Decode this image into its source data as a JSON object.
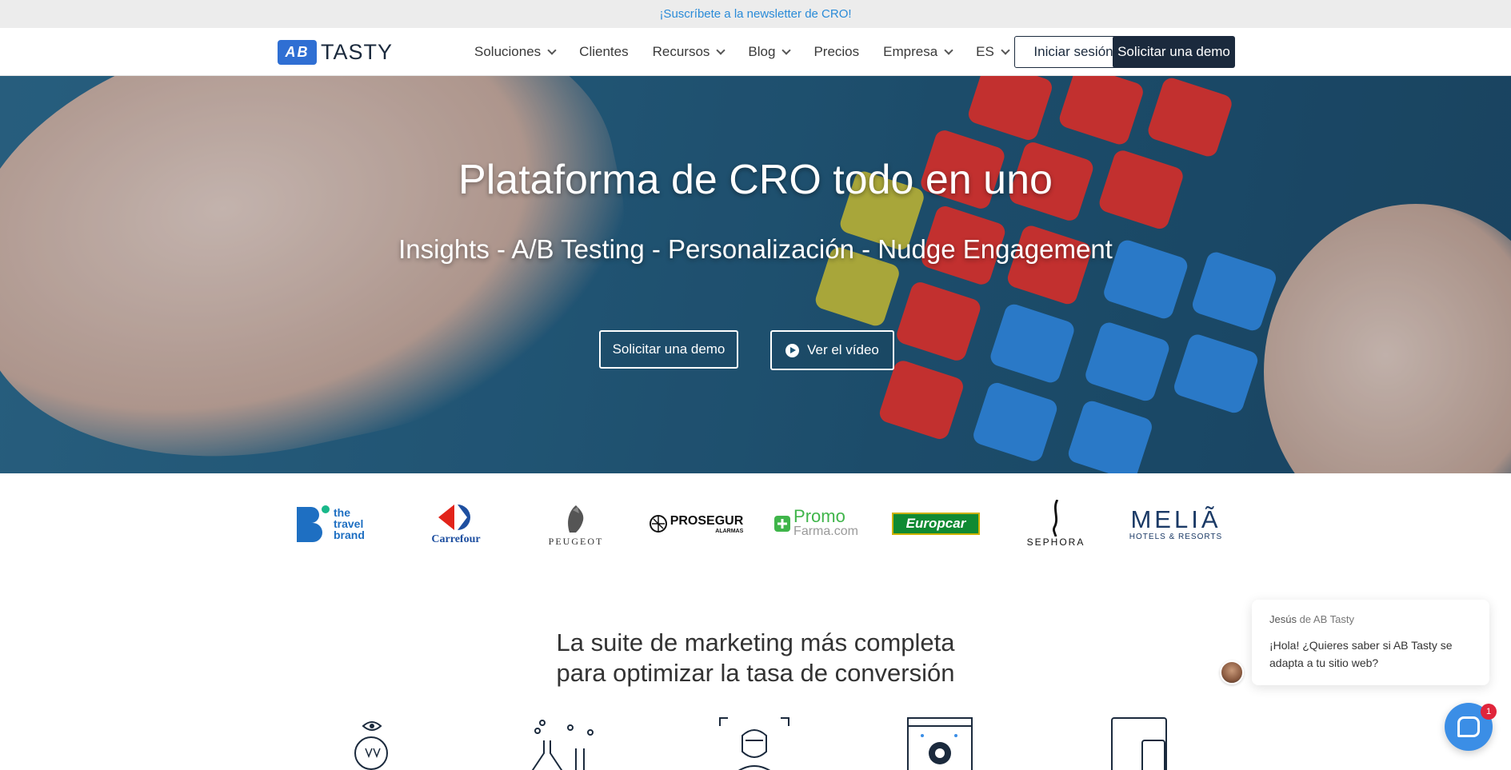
{
  "topbar": {
    "newsletter_link": "¡Suscríbete a la newsletter de CRO!"
  },
  "nav": {
    "logo_mark": "AB",
    "logo_text": "TASTY",
    "items": [
      {
        "label": "Soluciones",
        "has_dropdown": true
      },
      {
        "label": "Clientes",
        "has_dropdown": false
      },
      {
        "label": "Recursos",
        "has_dropdown": true
      },
      {
        "label": "Blog",
        "has_dropdown": true
      },
      {
        "label": "Precios",
        "has_dropdown": false
      },
      {
        "label": "Empresa",
        "has_dropdown": true
      },
      {
        "label": "ES",
        "has_dropdown": true
      }
    ],
    "login_label": "Iniciar sesión",
    "demo_label": "Solicitar una demo"
  },
  "hero": {
    "title": "Plataforma de CRO todo en uno",
    "subtitle": "Insights - A/B Testing - Personalización - Nudge Engagement",
    "primary_button": "Solicitar una demo",
    "video_button": "Ver el vídeo"
  },
  "clients": [
    {
      "name": "the travel brand",
      "icon": "the-travel-brand-logo"
    },
    {
      "name": "Carrefour",
      "icon": "carrefour-logo"
    },
    {
      "name": "PEUGEOT",
      "icon": "peugeot-logo"
    },
    {
      "name": "PROSEGUR",
      "sub": "ALARMAS",
      "icon": "prosegur-logo"
    },
    {
      "name": "Promo",
      "sub": "Farma.com",
      "icon": "promofarma-logo"
    },
    {
      "name": "Europcar",
      "icon": "europcar-logo"
    },
    {
      "name": "SEPHORA",
      "icon": "sephora-logo"
    },
    {
      "name": "MELIÃ",
      "sub": "HOTELS & RESORTS",
      "icon": "melia-logo"
    }
  ],
  "suite": {
    "line1": "La suite de marketing más completa",
    "line2": "para optimizar la tasa de conversión"
  },
  "features": [
    {
      "icon": "insights-eye-icon"
    },
    {
      "icon": "lab-flask-icon"
    },
    {
      "icon": "personalization-face-icon"
    },
    {
      "icon": "settings-gear-window-icon"
    },
    {
      "icon": "devices-icon"
    }
  ],
  "chat": {
    "from_name": "Jesús",
    "from_rest": " de AB Tasty",
    "message": "¡Hola! ¿Quieres saber si AB Tasty se adapta a tu sitio web?",
    "badge": "1"
  },
  "colors": {
    "brand_blue": "#2f6fd3",
    "navy": "#1b2a3d",
    "link_blue": "#2a8bd8",
    "chat_blue": "#3b8ee6"
  }
}
